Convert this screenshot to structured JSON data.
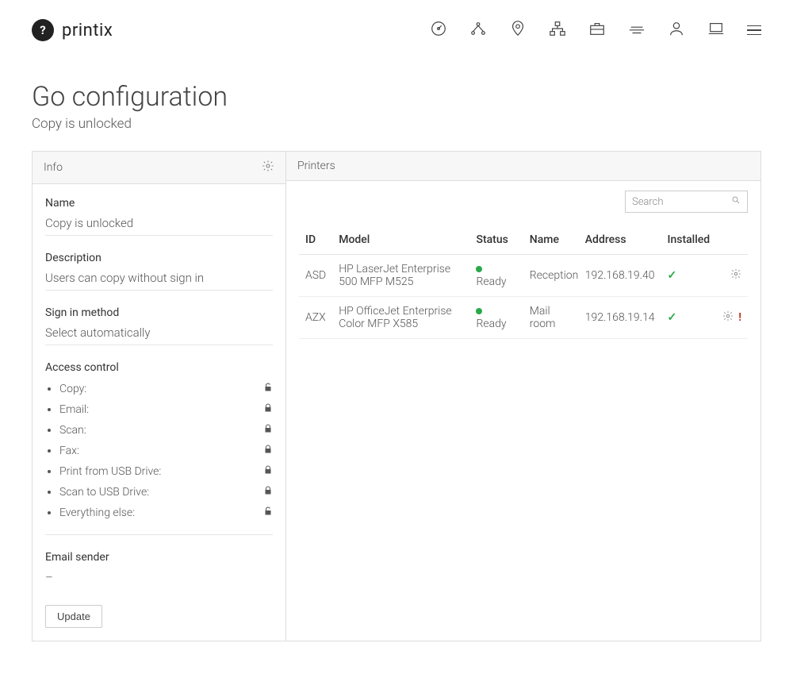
{
  "brand": {
    "name": "printix"
  },
  "nav": {
    "icons": [
      "dashboard",
      "share",
      "location",
      "sitemap",
      "briefcase",
      "queues",
      "user",
      "laptop",
      "menu"
    ]
  },
  "page": {
    "title": "Go configuration",
    "subtitle": "Copy is unlocked"
  },
  "info": {
    "panel_title": "Info",
    "name_label": "Name",
    "name_value": "Copy is unlocked",
    "description_label": "Description",
    "description_value": "Users can copy without sign in",
    "signin_label": "Sign in method",
    "signin_value": "Select automatically",
    "access_label": "Access control",
    "access_items": [
      {
        "label": "Copy:",
        "locked": false
      },
      {
        "label": "Email:",
        "locked": true
      },
      {
        "label": "Scan:",
        "locked": true
      },
      {
        "label": "Fax:",
        "locked": true
      },
      {
        "label": "Print from USB Drive:",
        "locked": true
      },
      {
        "label": "Scan to USB Drive:",
        "locked": true
      },
      {
        "label": "Everything else:",
        "locked": false
      }
    ],
    "email_sender_label": "Email sender",
    "email_sender_value": "–",
    "update_label": "Update"
  },
  "printers": {
    "panel_title": "Printers",
    "search_placeholder": "Search",
    "columns": {
      "id": "ID",
      "model": "Model",
      "status": "Status",
      "name": "Name",
      "address": "Address",
      "installed": "Installed"
    },
    "rows": [
      {
        "id": "ASD",
        "model": "HP LaserJet Enterprise 500 MFP M525",
        "status": "Ready",
        "name": "Reception",
        "address": "192.168.19.40",
        "installed": true,
        "warning": false
      },
      {
        "id": "AZX",
        "model": "HP OfficeJet Enterprise Color MFP X585",
        "status": "Ready",
        "name": "Mail room",
        "address": "192.168.19.14",
        "installed": true,
        "warning": true
      }
    ]
  }
}
